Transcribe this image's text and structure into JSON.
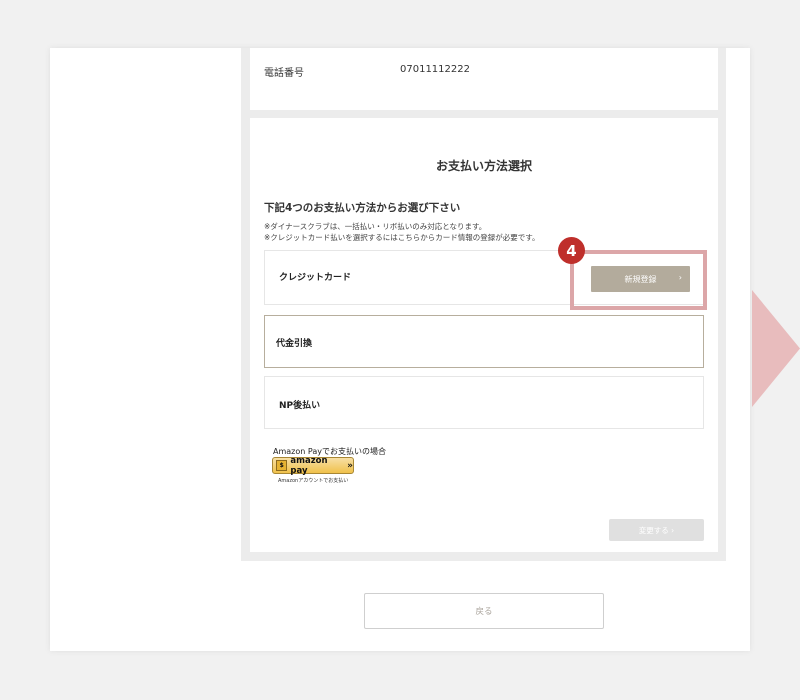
{
  "contact": {
    "phone_label": "電話番号",
    "phone_value": "07011112222"
  },
  "payment": {
    "title": "お支払い方法選択",
    "subtitle": "下記4つのお支払い方法からお選び下さい",
    "notes": [
      "※ダイナースクラブは、一括払い・リボ払いのみ対応となります。",
      "※クレジットカード払いを選択するにはこちらからカード情報の登録が必要です。"
    ],
    "options": [
      {
        "label": "クレジットカード",
        "selected": false
      },
      {
        "label": "代金引換",
        "selected": true
      },
      {
        "label": "NP後払い",
        "selected": false
      }
    ],
    "register_button": "新規登録",
    "register_chevron": "›",
    "amazon": {
      "heading": "Amazon Payでお支払いの場合",
      "button_icon": "$",
      "button_label": "amazon pay",
      "button_chevron": "»",
      "note": "Amazonアカウントでお支払い"
    },
    "change_button": "変更する ›"
  },
  "back_button": "戻る",
  "annotation": {
    "step_number": "4",
    "highlight_color": "#dca6a8",
    "badge_color": "#bf2f2b",
    "arrow_color": "#e8bcbd"
  },
  "colors": {
    "accent_button": "#b3ab9c",
    "selected_border": "#b7ae9d"
  }
}
